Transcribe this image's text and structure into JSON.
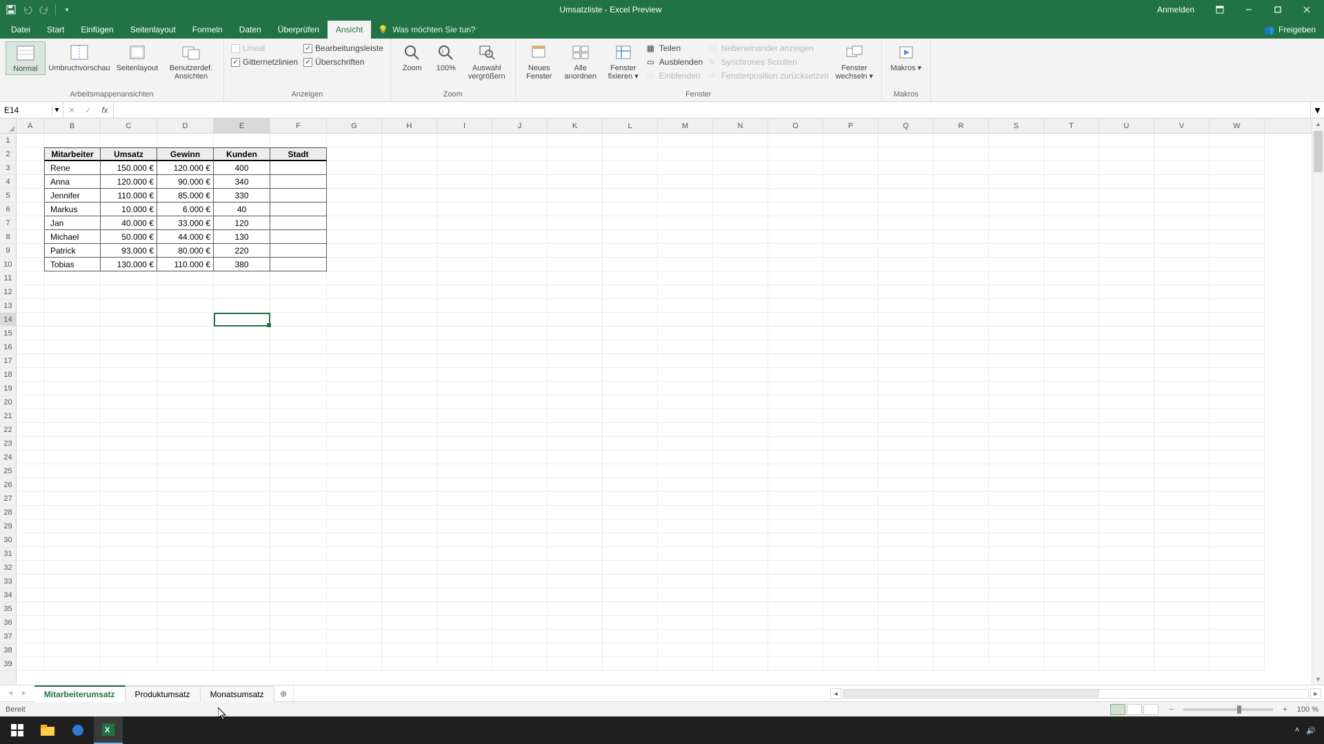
{
  "app": {
    "title": "Umsatzliste  -  Excel Preview",
    "signin": "Anmelden"
  },
  "tabs": {
    "items": [
      "Datei",
      "Start",
      "Einfügen",
      "Seitenlayout",
      "Formeln",
      "Daten",
      "Überprüfen",
      "Ansicht"
    ],
    "active": "Ansicht",
    "tellme": "Was möchten Sie tun?",
    "share": "Freigeben"
  },
  "ribbon": {
    "views": {
      "normal": "Normal",
      "pagebreak": "Umbruchvorschau",
      "pagelayout": "Seitenlayout",
      "custom": "Benutzerdef. Ansichten",
      "group": "Arbeitsmappenansichten"
    },
    "show": {
      "ruler": "Lineal",
      "formulabar": "Bearbeitungsleiste",
      "gridlines": "Gitternetzlinien",
      "headings": "Überschriften",
      "group": "Anzeigen"
    },
    "zoom": {
      "zoom": "Zoom",
      "hundred": "100%",
      "selection": "Auswahl vergrößern",
      "group": "Zoom"
    },
    "window": {
      "neww": "Neues Fenster",
      "arrange": "Alle anordnen",
      "freeze": "Fenster fixieren ▾",
      "split": "Teilen",
      "hide": "Ausblenden",
      "unhide": "Einblenden",
      "side": "Nebeneinander anzeigen",
      "sync": "Synchrones Scrollen",
      "reset": "Fensterposition zurücksetzen",
      "switch": "Fenster wechseln ▾",
      "group": "Fenster"
    },
    "macros": {
      "macros": "Makros ▾",
      "group": "Makros"
    }
  },
  "namebox": "E14",
  "columns": [
    "A",
    "B",
    "C",
    "D",
    "E",
    "F",
    "G",
    "H",
    "I",
    "J",
    "K",
    "L",
    "M",
    "N",
    "O",
    "P",
    "Q",
    "R",
    "S",
    "T",
    "U",
    "V",
    "W"
  ],
  "table": {
    "headers": [
      "Mitarbeiter",
      "Umsatz",
      "Gewinn",
      "Kunden",
      "Stadt"
    ],
    "rows": [
      [
        "Rene",
        "150.000 €",
        "120.000 €",
        "400",
        ""
      ],
      [
        "Anna",
        "120.000 €",
        "90.000 €",
        "340",
        ""
      ],
      [
        "Jennifer",
        "110.000 €",
        "85.000 €",
        "330",
        ""
      ],
      [
        "Markus",
        "10.000 €",
        "6.000 €",
        "40",
        ""
      ],
      [
        "Jan",
        "40.000 €",
        "33.000 €",
        "120",
        ""
      ],
      [
        "Michael",
        "50.000 €",
        "44.000 €",
        "130",
        ""
      ],
      [
        "Patrick",
        "93.000 €",
        "80.000 €",
        "220",
        ""
      ],
      [
        "Tobias",
        "130.000 €",
        "110.000 €",
        "380",
        ""
      ]
    ]
  },
  "sheets": {
    "items": [
      "Mitarbeiterumsatz",
      "Produktumsatz",
      "Monatsumsatz"
    ],
    "active": "Mitarbeiterumsatz"
  },
  "status": {
    "ready": "Bereit",
    "zoom": "100 %"
  },
  "selection": {
    "col": "E",
    "row": 14
  }
}
